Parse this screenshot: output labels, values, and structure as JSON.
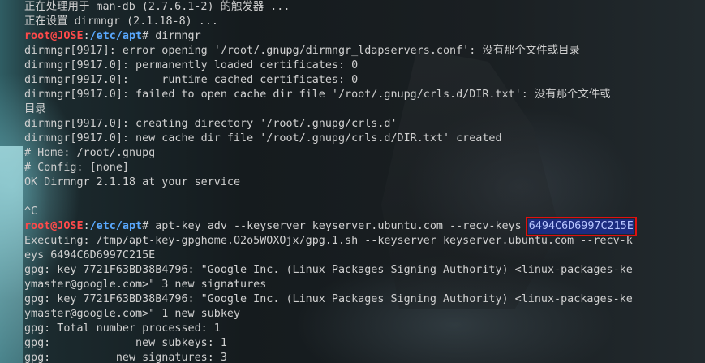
{
  "prompt": {
    "user": "root@JOSE",
    "sep": ":",
    "path1": "/etc/apt",
    "end": "# "
  },
  "top": [
    "正在处理用于 man-db (2.7.6.1-2) 的触发器 ...",
    "正在设置 dirmngr (2.1.18-8) ..."
  ],
  "cmd1": "dirmngr",
  "out1": [
    "dirmngr[9917]: error opening '/root/.gnupg/dirmngr_ldapservers.conf': 没有那个文件或目录",
    "dirmngr[9917.0]: permanently loaded certificates: 0",
    "dirmngr[9917.0]:     runtime cached certificates: 0",
    "dirmngr[9917.0]: failed to open cache dir file '/root/.gnupg/crls.d/DIR.txt': 没有那个文件或",
    "目录",
    "dirmngr[9917.0]: creating directory '/root/.gnupg/crls.d'",
    "dirmngr[9917.0]: new cache dir file '/root/.gnupg/crls.d/DIR.txt' created",
    "# Home: /root/.gnupg",
    "# Config: [none]",
    "OK Dirmngr 2.1.18 at your service",
    "",
    "^C"
  ],
  "cmd2": "apt-key adv --keyserver keyserver.ubuntu.com --recv-keys ",
  "cmd2_key": "6494C6D6997C215E",
  "out2": [
    "Executing: /tmp/apt-key-gpghome.O2o5WOXOjx/gpg.1.sh --keyserver keyserver.ubuntu.com --recv-k",
    "eys 6494C6D6997C215E",
    "gpg: key 7721F63BD38B4796: \"Google Inc. (Linux Packages Signing Authority) <linux-packages-ke",
    "ymaster@google.com>\" 3 new signatures",
    "gpg: key 7721F63BD38B4796: \"Google Inc. (Linux Packages Signing Authority) <linux-packages-ke",
    "ymaster@google.com>\" 1 new subkey",
    "gpg: Total number processed: 1",
    "gpg:             new subkeys: 1",
    "gpg:          new signatures: 3"
  ]
}
